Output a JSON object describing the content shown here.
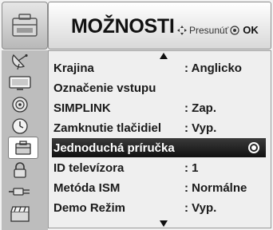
{
  "header": {
    "title": "MOŽNOSTI",
    "hint_move": "Presunúť",
    "hint_ok": "OK",
    "icon": "options-toolbox-icon"
  },
  "sidebar": {
    "icons": [
      {
        "name": "satellite-dish-icon"
      },
      {
        "name": "tv-picture-icon"
      },
      {
        "name": "speaker-audio-icon"
      },
      {
        "name": "clock-time-icon"
      },
      {
        "name": "options-toolbox-icon",
        "active": true
      },
      {
        "name": "lock-icon"
      },
      {
        "name": "input-plug-icon"
      },
      {
        "name": "media-clapper-icon"
      }
    ]
  },
  "menu": {
    "items": [
      {
        "label": "Krajina",
        "value": ": Anglicko"
      },
      {
        "label": "Označenie vstupu",
        "value": ""
      },
      {
        "label": "SIMPLINK",
        "value": ": Zap."
      },
      {
        "label": "Zamknutie tlačidiel",
        "value": ": Vyp."
      },
      {
        "label": "Jednoduchá príručka",
        "value": "",
        "selected": true
      },
      {
        "label": "ID televízora",
        "value": ": 1"
      },
      {
        "label": "Metóda ISM",
        "value": ": Normálne"
      },
      {
        "label": "Demo Režim",
        "value": ": Vyp."
      }
    ]
  },
  "colors": {
    "selected_bg": "#1a1a1a",
    "panel_bg": "#efefef",
    "sidebar_bg": "#bdbdbd"
  }
}
